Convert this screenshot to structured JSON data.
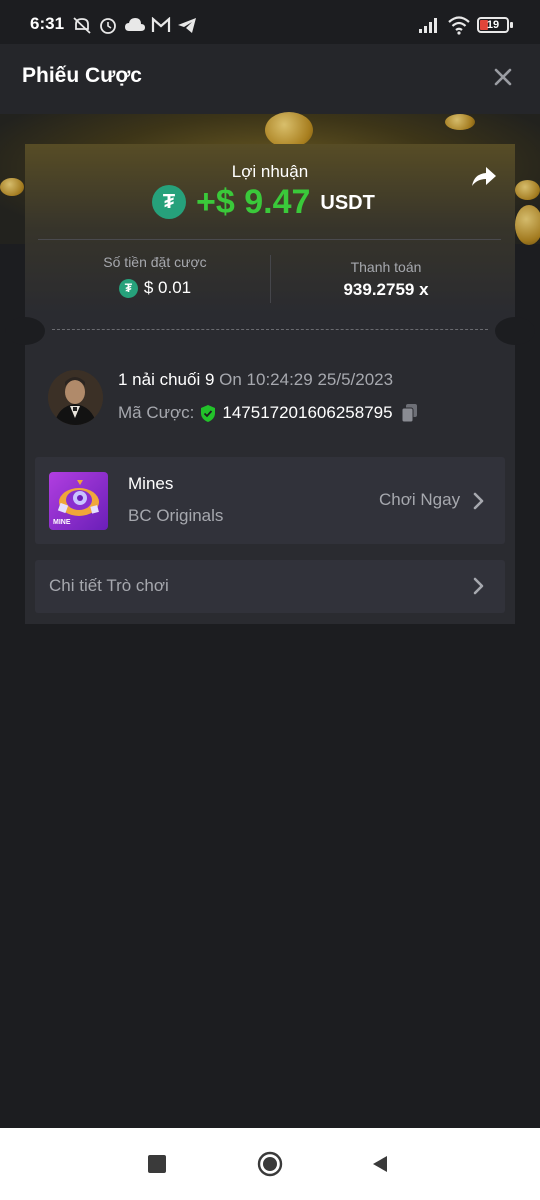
{
  "status_bar": {
    "time": "6:31",
    "battery": "19",
    "icons": [
      "mute-icon",
      "alarm-icon",
      "cloud-icon",
      "gmail-icon",
      "telegram-icon",
      "signal-icon",
      "wifi-icon",
      "battery-icon"
    ]
  },
  "header": {
    "title": "Phiếu Cược",
    "close_icon": "close-icon"
  },
  "profit": {
    "label": "Lợi nhuận",
    "value": "+$ 9.47",
    "unit": "USDT",
    "currency_icon": "tether-icon",
    "share_icon": "share-icon"
  },
  "bet_amount": {
    "label": "Số tiền đặt cược",
    "value": "$ 0.01"
  },
  "payout": {
    "label": "Thanh toán",
    "value": "939.2759 x"
  },
  "user": {
    "name": "1 nải chuối 9",
    "on_time": "On 10:24:29 25/5/2023",
    "bet_id_label": "Mã Cược:",
    "bet_id": "147517201606258795"
  },
  "game": {
    "name": "Mines",
    "provider": "BC Originals",
    "play_label": "Chơi Ngay",
    "thumb_label": "MINE"
  },
  "details": {
    "label": "Chi tiết Trò chơi"
  },
  "colors": {
    "background": "#1c1d20",
    "card": "#2a2b30",
    "row": "#31323a",
    "profit_green": "#3ac93a",
    "tether_green": "#26a17b",
    "muted_text": "#a6a8ae"
  }
}
